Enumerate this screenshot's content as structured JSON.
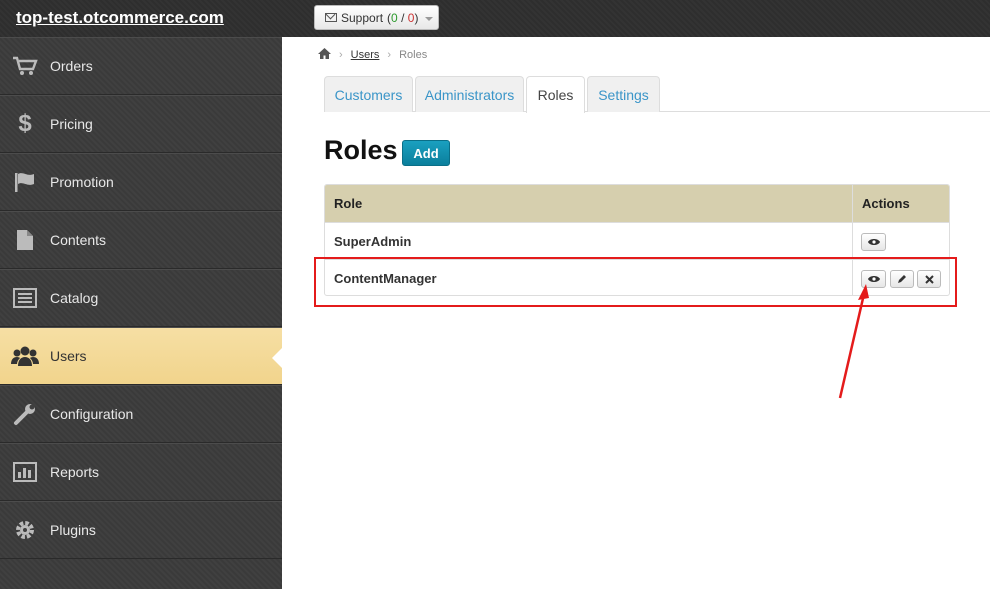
{
  "header": {
    "site": "top-test.otcommerce.com",
    "support_label": "Support",
    "support_open": "0",
    "support_sep": "/",
    "support_closed": "0"
  },
  "sidebar": {
    "items": [
      {
        "label": "Orders",
        "icon": "cart-icon"
      },
      {
        "label": "Pricing",
        "icon": "dollar-icon"
      },
      {
        "label": "Promotion",
        "icon": "flag-icon"
      },
      {
        "label": "Contents",
        "icon": "document-icon"
      },
      {
        "label": "Catalog",
        "icon": "catalog-icon"
      },
      {
        "label": "Users",
        "icon": "users-icon",
        "active": true
      },
      {
        "label": "Configuration",
        "icon": "wrench-icon"
      },
      {
        "label": "Reports",
        "icon": "bar-chart-icon"
      },
      {
        "label": "Plugins",
        "icon": "gear-icon"
      }
    ]
  },
  "breadcrumb": {
    "home_icon": "home-icon",
    "link": "Users",
    "current": "Roles"
  },
  "tabs": [
    {
      "label": "Customers"
    },
    {
      "label": "Administrators"
    },
    {
      "label": "Roles",
      "active": true
    },
    {
      "label": "Settings"
    }
  ],
  "page": {
    "title": "Roles",
    "add_label": "Add"
  },
  "table": {
    "headers": {
      "role": "Role",
      "actions": "Actions"
    },
    "rows": [
      {
        "name": "SuperAdmin",
        "actions": [
          "view"
        ]
      },
      {
        "name": "ContentManager",
        "actions": [
          "view",
          "edit",
          "delete"
        ]
      }
    ]
  },
  "colors": {
    "accent": "#0b7f9c",
    "annotation": "#e41b1b",
    "active_nav": "#f1d48c",
    "table_header": "#d6cfae"
  }
}
